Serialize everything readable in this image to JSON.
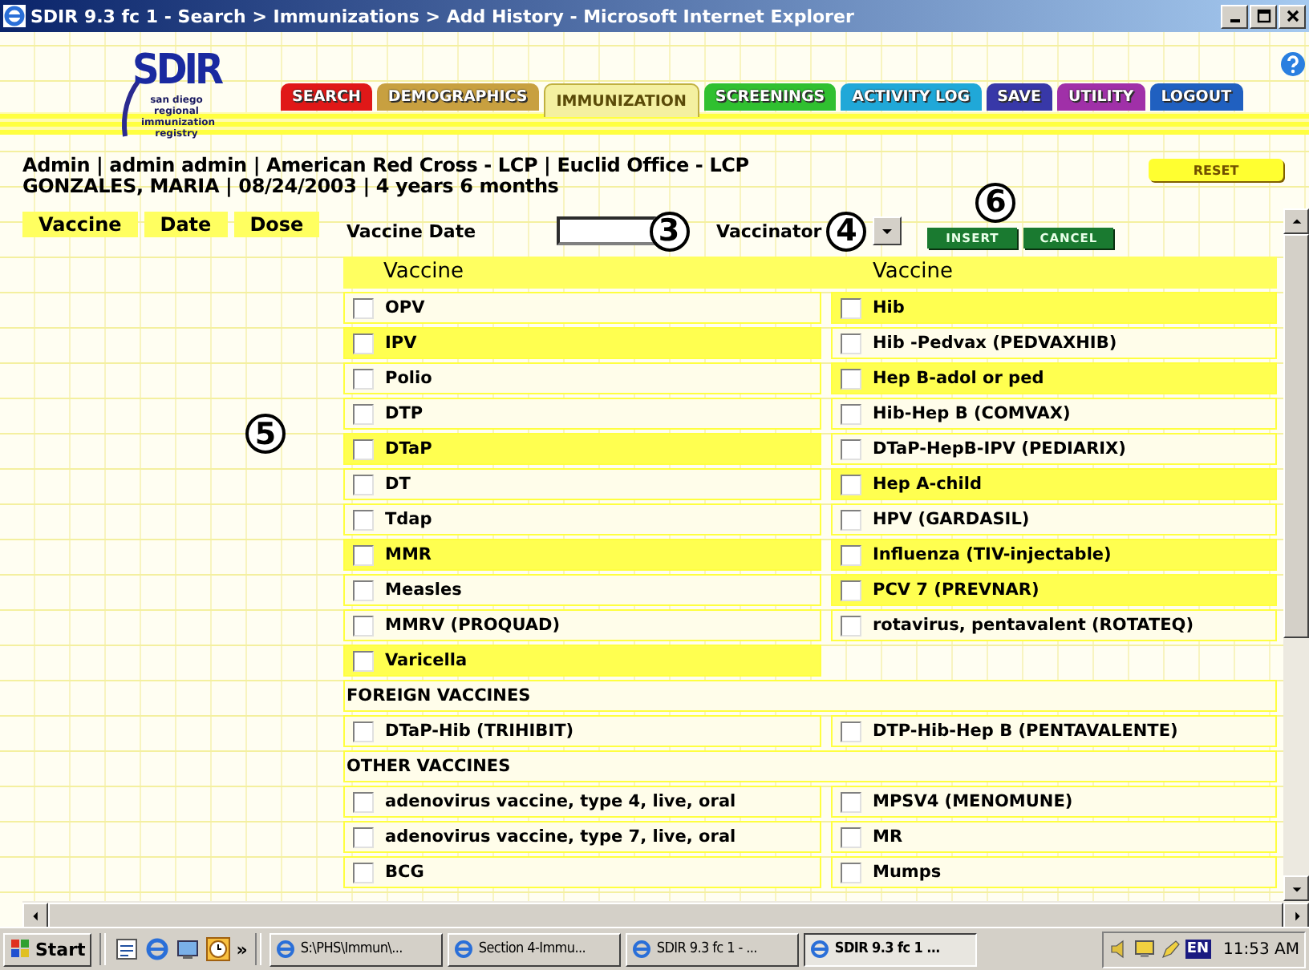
{
  "window": {
    "title": "SDIR 9.3 fc 1 - Search > Immunizations > Add History - Microsoft Internet Explorer"
  },
  "logo": {
    "name": "SDIR",
    "tagline": "san diego regional immunization registry"
  },
  "tabs": [
    {
      "label": "SEARCH",
      "color": "#e01818",
      "selected": false
    },
    {
      "label": "DEMOGRAPHICS",
      "color": "#c8a040",
      "selected": false
    },
    {
      "label": "IMMUNIZATION",
      "color": "#f4f0a0",
      "selected": true
    },
    {
      "label": "SCREENINGS",
      "color": "#30c030",
      "selected": false
    },
    {
      "label": "ACTIVITY LOG",
      "color": "#20a8d8",
      "selected": false
    },
    {
      "label": "SAVE",
      "color": "#3838a8",
      "selected": false
    },
    {
      "label": "UTILITY",
      "color": "#a030a8",
      "selected": false
    },
    {
      "label": "LOGOUT",
      "color": "#2060c0",
      "selected": false
    }
  ],
  "user_info": "Admin | admin admin | American Red Cross - LCP | Euclid Office - LCP",
  "patient_info": "GONZALES, MARIA | 08/24/2003 | 4 years 6 months",
  "reset_button": "RESET",
  "history_columns": [
    "Vaccine",
    "Date",
    "Dose"
  ],
  "form": {
    "vaccine_date_label": "Vaccine Date",
    "vaccinator_label": "Vaccinator",
    "insert_button": "INSERT",
    "cancel_button": "CANCEL"
  },
  "callouts": {
    "date": "3",
    "vaccinator": "4",
    "history": "5",
    "buttons": "6"
  },
  "vaccine_table": {
    "column_headers": [
      "Vaccine",
      "Vaccine"
    ],
    "groups": [
      {
        "left": [
          {
            "name": "OPV",
            "checked": false,
            "highlighted": false
          },
          {
            "name": "IPV",
            "checked": false,
            "highlighted": true
          },
          {
            "name": "Polio",
            "checked": false,
            "highlighted": false
          },
          {
            "name": "DTP",
            "checked": false,
            "highlighted": false
          },
          {
            "name": "DTaP",
            "checked": false,
            "highlighted": true
          },
          {
            "name": "DT",
            "checked": false,
            "highlighted": false
          },
          {
            "name": "Tdap",
            "checked": false,
            "highlighted": false
          },
          {
            "name": "MMR",
            "checked": false,
            "highlighted": true
          },
          {
            "name": "Measles",
            "checked": false,
            "highlighted": false
          },
          {
            "name": "MMRV (PROQUAD)",
            "checked": false,
            "highlighted": false
          },
          {
            "name": "Varicella",
            "checked": false,
            "highlighted": true
          }
        ],
        "right": [
          {
            "name": "Hib",
            "checked": false,
            "highlighted": true
          },
          {
            "name": "Hib -Pedvax (PEDVAXHIB)",
            "checked": false,
            "highlighted": false
          },
          {
            "name": "Hep B-adol or ped",
            "checked": false,
            "highlighted": true
          },
          {
            "name": "Hib-Hep B (COMVAX)",
            "checked": false,
            "highlighted": false
          },
          {
            "name": "DTaP-HepB-IPV (PEDIARIX)",
            "checked": false,
            "highlighted": false
          },
          {
            "name": "Hep A-child",
            "checked": false,
            "highlighted": true
          },
          {
            "name": "HPV (GARDASIL)",
            "checked": false,
            "highlighted": false
          },
          {
            "name": "Influenza (TIV-injectable)",
            "checked": false,
            "highlighted": true
          },
          {
            "name": "PCV 7 (PREVNAR)",
            "checked": false,
            "highlighted": true
          },
          {
            "name": "rotavirus, pentavalent (ROTATEQ)",
            "checked": false,
            "highlighted": false
          }
        ]
      },
      {
        "heading": "FOREIGN VACCINES",
        "left": [
          {
            "name": "DTaP-Hib (TRIHIBIT)",
            "checked": false,
            "highlighted": false
          }
        ],
        "right": [
          {
            "name": "DTP-Hib-Hep B (PENTAVALENTE)",
            "checked": false,
            "highlighted": false
          }
        ]
      },
      {
        "heading": "OTHER VACCINES",
        "left": [
          {
            "name": "adenovirus vaccine, type 4, live, oral",
            "checked": false,
            "highlighted": false
          },
          {
            "name": "adenovirus vaccine, type 7, live, oral",
            "checked": false,
            "highlighted": false
          },
          {
            "name": "BCG",
            "checked": false,
            "highlighted": false
          }
        ],
        "right": [
          {
            "name": "MPSV4 (MENOMUNE)",
            "checked": false,
            "highlighted": false
          },
          {
            "name": "MR",
            "checked": false,
            "highlighted": false
          },
          {
            "name": "Mumps",
            "checked": false,
            "highlighted": false
          }
        ]
      }
    ]
  },
  "taskbar": {
    "start": "Start",
    "more": "»",
    "tasks": [
      {
        "label": "S:\\PHS\\Immun\\...",
        "selected": false
      },
      {
        "label": "Section 4-Immu...",
        "selected": false
      },
      {
        "label": "SDIR 9.3 fc 1 - ...",
        "selected": false
      },
      {
        "label": "SDIR 9.3 fc 1 ...",
        "selected": true
      }
    ],
    "language": "EN",
    "clock": "11:53 AM"
  }
}
